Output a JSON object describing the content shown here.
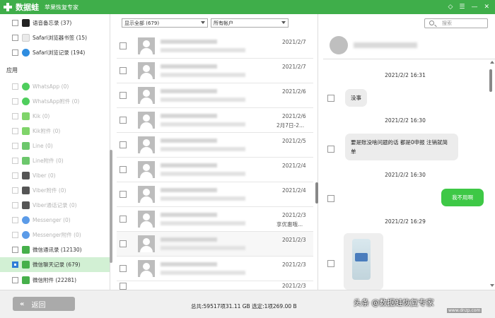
{
  "titlebar": {
    "app_name": "数据蛙",
    "subtitle": "苹果恢复专家",
    "controls": [
      "◇",
      "☰",
      "—",
      "✕"
    ]
  },
  "sidebar": {
    "top_items": [
      {
        "label": "语音备忘录 (37)",
        "icon": "voice-memo-icon",
        "icon_color": "#222222",
        "state": "enabled",
        "checked": false
      },
      {
        "label": "Safari浏览器书签 (15)",
        "icon": "safari-bookmark-icon",
        "icon_color": "#eaeaea",
        "state": "enabled",
        "checked": false
      },
      {
        "label": "Safari浏览记录 (194)",
        "icon": "safari-history-icon",
        "icon_color": "#2f8de0",
        "state": "enabled",
        "checked": false
      }
    ],
    "section_heading": "应用",
    "app_items": [
      {
        "label": "WhatsApp (0)",
        "icon": "whatsapp-icon",
        "icon_color": "#4fce5d",
        "state": "disabled"
      },
      {
        "label": "WhatsApp附件 (0)",
        "icon": "whatsapp-attachment-icon",
        "icon_color": "#4fce5d",
        "state": "disabled"
      },
      {
        "label": "Kik (0)",
        "icon": "kik-icon",
        "icon_color": "#7fd46a",
        "state": "disabled"
      },
      {
        "label": "Kik附件 (0)",
        "icon": "kik-attachment-icon",
        "icon_color": "#7fd46a",
        "state": "disabled"
      },
      {
        "label": "Line (0)",
        "icon": "line-icon",
        "icon_color": "#6cc76c",
        "state": "disabled"
      },
      {
        "label": "Line附件 (0)",
        "icon": "line-attachment-icon",
        "icon_color": "#6cc76c",
        "state": "disabled"
      },
      {
        "label": "Viber (0)",
        "icon": "viber-icon",
        "icon_color": "#555555",
        "state": "disabled"
      },
      {
        "label": "Viber附件 (0)",
        "icon": "viber-attachment-icon",
        "icon_color": "#555555",
        "state": "disabled"
      },
      {
        "label": "Viber通话记录 (0)",
        "icon": "viber-call-log-icon",
        "icon_color": "#555555",
        "state": "disabled"
      },
      {
        "label": "Messenger (0)",
        "icon": "messenger-icon",
        "icon_color": "#5b9be8",
        "state": "disabled"
      },
      {
        "label": "Messenger附件 (0)",
        "icon": "messenger-attachment-icon",
        "icon_color": "#5b9be8",
        "state": "disabled"
      },
      {
        "label": "微信通讯录 (12130)",
        "icon": "wechat-contacts-icon",
        "icon_color": "#46b04b",
        "state": "enabled",
        "checked": false
      },
      {
        "label": "微信聊天记录 (679)",
        "icon": "wechat-chat-icon",
        "icon_color": "#46b04b",
        "state": "selected",
        "checked": true
      },
      {
        "label": "微信附件 (22281)",
        "icon": "wechat-attachment-icon",
        "icon_color": "#46b04b",
        "state": "enabled",
        "checked": false
      }
    ]
  },
  "filters": {
    "show_all": "显示全部 (679)",
    "accounts": "所有帐户"
  },
  "list": {
    "rows": [
      {
        "date": "2021/2/7",
        "extra": ""
      },
      {
        "date": "2021/2/7",
        "extra": ""
      },
      {
        "date": "2021/2/6",
        "extra": ""
      },
      {
        "date": "2021/2/6",
        "extra": "2月7日-2..."
      },
      {
        "date": "2021/2/5",
        "extra": ""
      },
      {
        "date": "2021/2/4",
        "extra": ""
      },
      {
        "date": "2021/2/4",
        "extra": ""
      },
      {
        "date": "2021/2/3",
        "extra": "享优惠哦..."
      },
      {
        "date": "2021/2/3",
        "extra": ""
      },
      {
        "date": "2021/2/3",
        "extra": ""
      },
      {
        "date": "2021/2/3",
        "extra": ""
      }
    ]
  },
  "search": {
    "placeholder": "搜索"
  },
  "chat": {
    "timestamps": [
      "2021/2/2 16:31",
      "2021/2/2 16:30",
      "2021/2/2 16:30",
      "2021/2/2 16:29"
    ],
    "messages": [
      {
        "text": "没事",
        "side": "left"
      },
      {
        "text": "要是账没啥问题的话 都是0申报 注销就简单",
        "side": "left"
      },
      {
        "text": "我不用啊",
        "side": "right"
      }
    ]
  },
  "bottom": {
    "back_label": "返回",
    "status": "总共:59517项31.11 GB 选定:1项269.00 B"
  },
  "watermark": {
    "text": "头条 @数据蛙恢复专家",
    "url": "www.dnzp.com"
  },
  "colors": {
    "accent": "#3fae4a",
    "selected_bg": "#d2f0d4",
    "my_bubble": "#3ec846",
    "other_bubble": "#ececec"
  }
}
